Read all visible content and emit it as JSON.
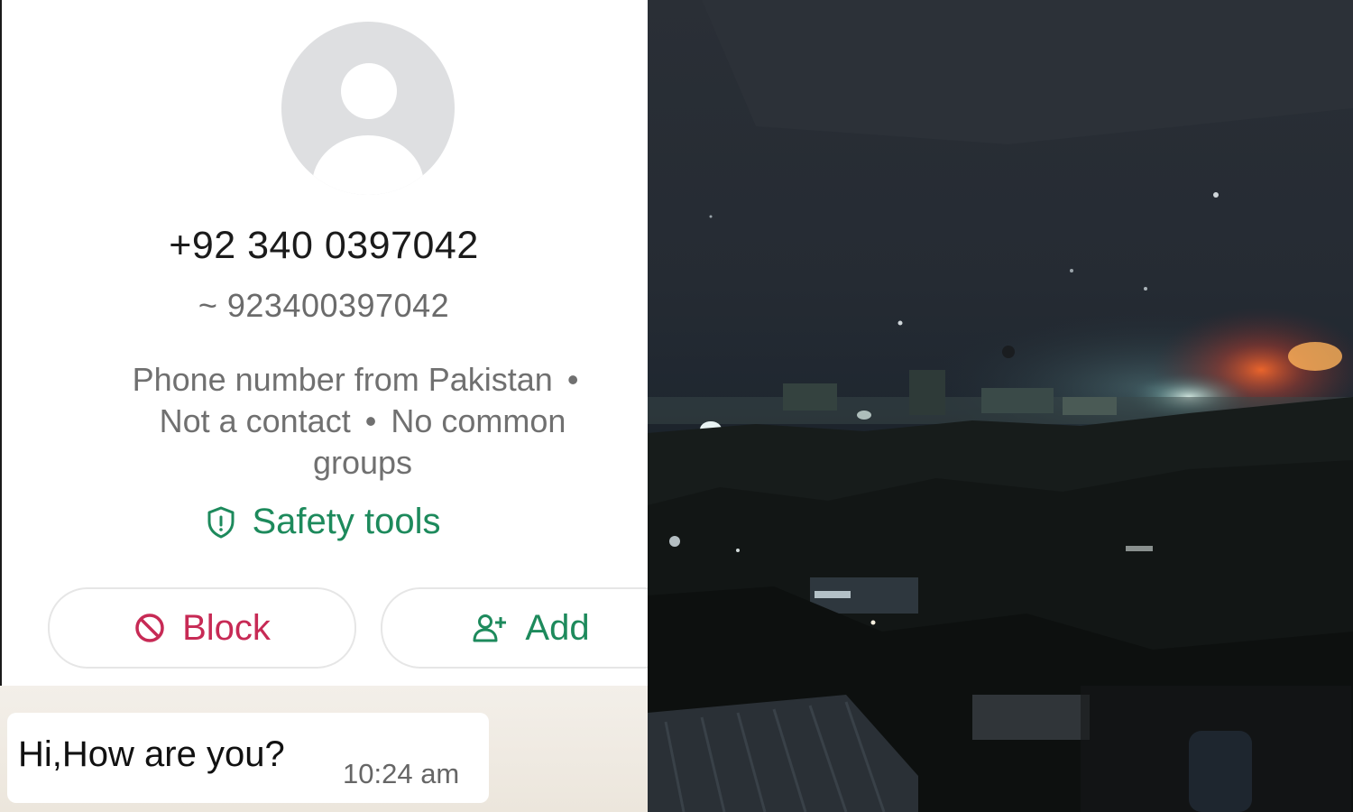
{
  "contact": {
    "phone_number": "+92 340 0397042",
    "alt_name": "~ 923400397042",
    "info_parts": [
      "Phone number from Pakistan",
      "Not a contact",
      "No common",
      "groups"
    ],
    "separator": "•",
    "safety_tools": "Safety tools",
    "accent_green": "#1d8a5c",
    "accent_red": "#c72a55"
  },
  "actions": {
    "block_label": "Block",
    "add_label": "Add"
  },
  "message": {
    "text": "Hi,How are you?",
    "time": "10:24 am"
  },
  "photo": {
    "subject": "night skyline with distant lights and fire glow"
  }
}
